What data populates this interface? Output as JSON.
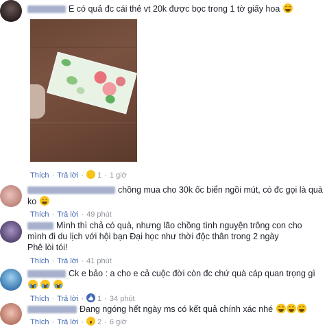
{
  "comments": [
    {
      "text": "E có quả đc cái thẻ vt 20k được bọc trong 1 tờ giấy hoa",
      "emojis": [
        "laugh"
      ],
      "actions": {
        "like": "Thích",
        "reply": "Trả lời",
        "reaction_count": "1",
        "time": "1 giờ"
      },
      "avatar_color": "#3b2c2c"
    },
    {
      "text_line1": "chồng mua cho 30k ốc biển ngồi mút, có đc gọi là quà",
      "text_line2": "ko",
      "emojis": [
        "laugh"
      ],
      "actions": {
        "like": "Thích",
        "reply": "Trả lời",
        "time": "49 phút"
      },
      "avatar_color": "#d9a6a0"
    },
    {
      "text_line1": "Mình thì chả có quà, nhưng lão chồng tình nguyện trông con cho",
      "text_line2": "mình đi du lịch với hội bạn Đại học như thời độc thân trong 2 ngày",
      "text_line3": "Phê lòi tói!",
      "actions": {
        "like": "Thích",
        "reply": "Trả lời",
        "time": "41 phút"
      },
      "avatar_color": "#6b5a8c"
    },
    {
      "text": "Ck e bảo : a cho e cả cuộc đời còn đc chứ quà cáp quan trọng gì",
      "emojis": [
        "cry",
        "cry",
        "cry"
      ],
      "actions": {
        "like": "Thích",
        "reply": "Trả lời",
        "reaction_count": "1",
        "time": "34 phút"
      },
      "avatar_color": "#4a8fc4"
    },
    {
      "text": "Đang ngóng hết ngày ms có kết quả chính xác nhé",
      "emojis": [
        "laugh",
        "laugh",
        "laugh"
      ],
      "actions": {
        "like": "Thích",
        "reply": "Trả lời",
        "reaction_count": "2",
        "time": "6 giờ"
      },
      "avatar_color": "#c9887a"
    }
  ],
  "colors": {
    "link": "#4267b2",
    "meta": "#90949c",
    "text": "#1d2129",
    "name_blur": "#9aa4c4"
  }
}
